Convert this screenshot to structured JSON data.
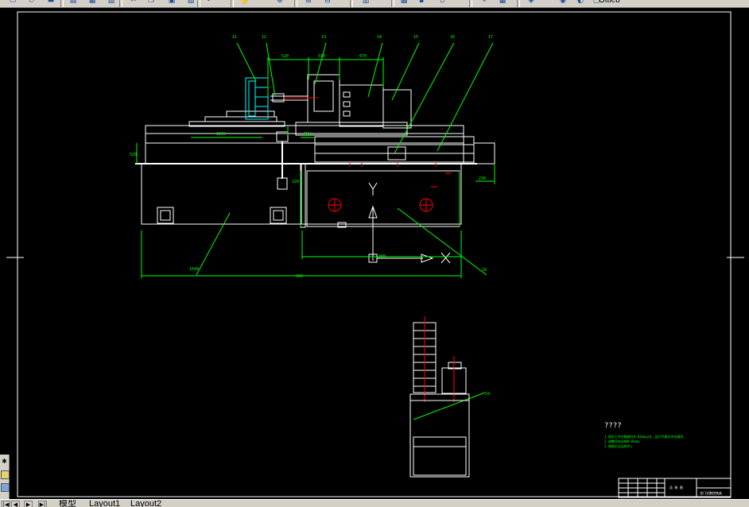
{
  "toolbar": {
    "layer_name": "Ottieb",
    "icons": [
      "new-icon",
      "open-icon",
      "save-icon",
      "print-icon",
      "preview-icon",
      "publish-icon",
      "cut-icon",
      "copy-icon",
      "paste-icon",
      "match-icon",
      "undo-icon",
      "pan-icon",
      "zoom-realtime-icon",
      "zoom-window-icon",
      "zoom-previous-icon",
      "properties-icon",
      "designcenter-icon",
      "toolpalette-icon",
      "sheetset-icon",
      "markup-icon",
      "calculator-icon",
      "layer-icon",
      "layer-state-icon",
      "layer-bulb-icon",
      "layer-lock-icon"
    ]
  },
  "tabs": {
    "model": "模型",
    "layout1": "Layout1",
    "layout2": "Layout2",
    "nav_first": "|◀",
    "nav_prev": "◀",
    "nav_next": "▶",
    "nav_last": "▶|"
  },
  "drawing": {
    "notes_title": "????",
    "notes": [
      "1.保证工作台精度在0.02mm以内，运行平稳无冲击噪声。",
      "2.调整导轨间隙0.05mm。",
      "3.装配后试运转2h。"
    ],
    "title_block_name": "龙门式数控铣床",
    "title_block_sub": "总 装 图",
    "leaders": [
      "11",
      "12",
      "13",
      "14",
      "15",
      "16",
      "17"
    ],
    "dims": [
      "520",
      "310",
      "670",
      "1200",
      "280",
      "520",
      "220",
      "230",
      "380",
      "960",
      "1640"
    ]
  }
}
